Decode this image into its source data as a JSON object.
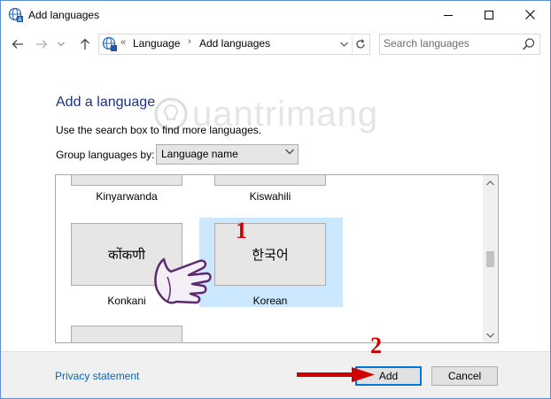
{
  "window": {
    "title": "Add languages"
  },
  "address": {
    "overflow_chevron": "«",
    "crumbs": [
      "Language",
      "Add languages"
    ],
    "separator": "›"
  },
  "search": {
    "placeholder": "Search languages"
  },
  "main": {
    "heading": "Add a language",
    "description": "Use the search box to find more languages.",
    "group_by_label": "Group languages by:",
    "group_by_value": "Language name"
  },
  "languages": [
    {
      "script": "",
      "name": "Kinyarwanda"
    },
    {
      "script": "",
      "name": "Kiswahili"
    },
    {
      "script": "कोंकणी",
      "name": "Konkani"
    },
    {
      "script": "한국어",
      "name": "Korean",
      "selected": true
    },
    {
      "script": "",
      "name": ""
    }
  ],
  "scrollbar": {
    "position_fraction": 0.5
  },
  "footer": {
    "privacy_link": "Privacy statement",
    "add_label": "Add",
    "cancel_label": "Cancel"
  },
  "annotations": {
    "step1": "1",
    "step2": "2",
    "watermark": "uantrimang",
    "accent_color": "#d00000"
  },
  "colors": {
    "heading": "#1e3287",
    "link": "#0066cc",
    "selection": "#cce8ff",
    "footer_bg": "#f0f0f0"
  }
}
